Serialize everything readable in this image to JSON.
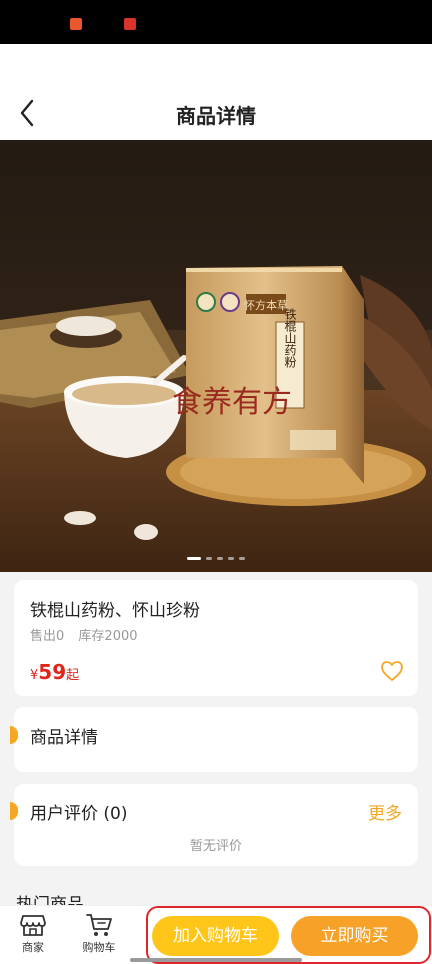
{
  "header": {
    "title": "商品详情"
  },
  "product": {
    "name": "铁棍山药粉、怀山珍粉",
    "sold": "售出0",
    "stock": "库存2000",
    "price_currency": "¥",
    "price_value": "59",
    "price_suffix": "起"
  },
  "hero": {
    "brand_label": "怀方本草",
    "box_title": "铁棍山药粉",
    "slogan": "食养有方",
    "slide_count": 5,
    "active_slide": 0
  },
  "sections": {
    "detail_title": "商品详情",
    "review_title": "用户评价 (0)",
    "review_more": "更多",
    "review_empty": "暂无评价",
    "hot_title": "热门商品"
  },
  "bottom_bar": {
    "shop_label": "商家",
    "cart_label": "购物车",
    "add_to_cart": "加入购物车",
    "buy_now": "立即购买"
  },
  "colors": {
    "accent": "#f5a623",
    "price": "#e0251b",
    "add_button": "#ffc619",
    "buy_button": "#f7a128",
    "highlight_box": "#e0262a"
  },
  "icons": [
    "back-arrow-icon",
    "heart-icon",
    "shop-icon",
    "cart-icon"
  ]
}
